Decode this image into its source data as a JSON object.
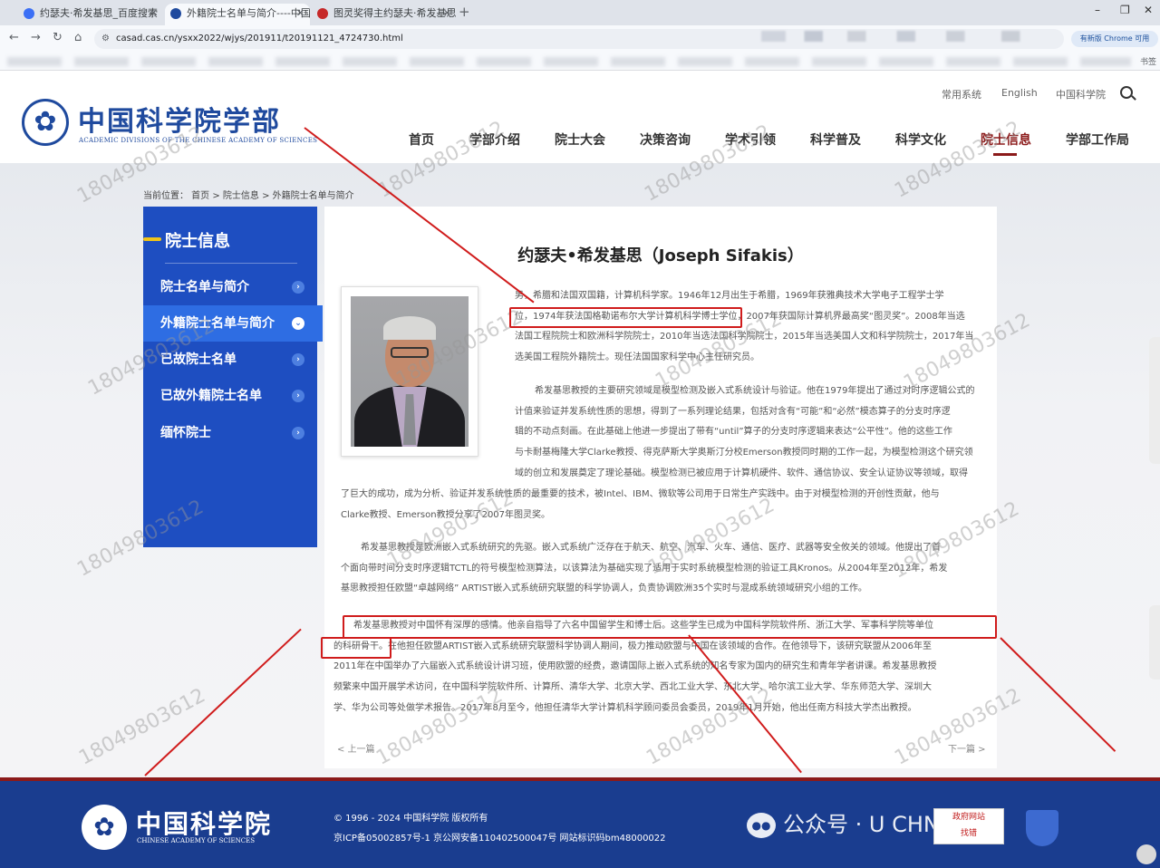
{
  "browser": {
    "tabs": [
      {
        "title": "约瑟夫·希发基思_百度搜索",
        "icon_color": "#3b6ff5"
      },
      {
        "title": "外籍院士名单与简介----中国科",
        "icon_color": "#1f4a9e"
      },
      {
        "title": "图灵奖得主约瑟夫·希发基思: 深",
        "icon_color": "#c62828"
      }
    ],
    "close_glyph": "✕",
    "new_tab_glyph": "+",
    "url": "casad.cas.cn/ysxx2022/wjys/201911/t20191121_4724730.html",
    "chrome_notice": "有新版 Chrome 可用",
    "bookmarks_right": "书签"
  },
  "header": {
    "logo_cn": "中国科学院学部",
    "logo_en": "ACADEMIC DIVISIONS OF THE CHINESE ACADEMY OF SCIENCES",
    "top_links": [
      "常用系统",
      "English",
      "中国科学院"
    ],
    "nav": [
      "首页",
      "学部介绍",
      "院士大会",
      "决策咨询",
      "学术引领",
      "科学普及",
      "科学文化",
      "院士信息",
      "学部工作局"
    ],
    "nav_active": "院士信息",
    "accent_color": "#8b1a1a",
    "brand_color": "#1f4a9e"
  },
  "breadcrumb": "当前位置： 首页 > 院士信息 > 外籍院士名单与简介",
  "sidebar": {
    "title": "院士信息",
    "items": [
      {
        "label": "院士名单与简介",
        "active": false
      },
      {
        "label": "外籍院士名单与简介",
        "active": true
      },
      {
        "label": "已故院士名单",
        "active": false
      },
      {
        "label": "已故外籍院士名单",
        "active": false
      },
      {
        "label": "缅怀院士",
        "active": false
      }
    ],
    "color": "#1e4ec1"
  },
  "article": {
    "title": "约瑟夫•希发基思（Joseph Sifakis）",
    "paragraphs": [
      [
        "男，希腊和法国双国籍，计算机科学家。1946年12月出生于希腊，1969年获雅典技术大学电子工程学士学",
        "位，1974年获法国格勒诺布尔大学计算机科学博士学位，2007年获国际计算机界最高奖“图灵奖”。2008年当选",
        "法国工程院院士和欧洲科学院院士，2010年当选法国科学院院士，2015年当选美国人文和科学院院士，2017年当",
        "选美国工程院外籍院士。现任法国国家科学中心主任研究员。"
      ],
      [
        "希发基思教授的主要研究领域是模型检测及嵌入式系统设计与验证。他在1979年提出了通过对时序逻辑公式的",
        "计值来验证并发系统性质的思想，得到了一系列理论结果，包括对含有“可能”和“必然”模态算子的分支时序逻",
        "辑的不动点刻画。在此基础上他进一步提出了带有“until”算子的分支时序逻辑来表达“公平性”。他的这些工作",
        "与卡耐基梅隆大学Clarke教授、得克萨斯大学奥斯汀分校Emerson教授同时期的工作一起，为模型检测这个研究领",
        "域的创立和发展奠定了理论基础。模型检测已被应用于计算机硬件、软件、通信协议、安全认证协议等领域，取得",
        "了巨大的成功，成为分析、验证并发系统性质的最重要的技术，被Intel、IBM、微软等公司用于日常生产实践中。由于对模型检测的开创性贡献，他与",
        "Clarke教授、Emerson教授分享了2007年图灵奖。"
      ],
      [
        "希发基思教授是欧洲嵌入式系统研究的先驱。嵌入式系统广泛存在于航天、航空、汽车、火车、通信、医疗、武器等安全攸关的领域。他提出了首",
        "个面向带时间分支时序逻辑TCTL的符号模型检测算法，以该算法为基础实现了适用于实时系统模型检测的验证工具Kronos。从2004年至2012年，希发",
        "基思教授担任欧盟“卓越网络” ARTIST嵌入式系统研究联盟的科学协调人，负责协调欧洲35个实时与混成系统领域研究小组的工作。"
      ],
      [
        "希发基思教授对中国怀有深厚的感情。他亲自指导了六名中国留学生和博士后。这些学生已成为中国科学院软件所、浙江大学、军事科学院等单位",
        "的科研骨干。在他担任欧盟ARTIST嵌入式系统研究联盟科学协调人期间，极力推动欧盟与中国在该领域的合作。在他领导下，该研究联盟从2006年至",
        "2011年在中国举办了六届嵌入式系统设计讲习班，使用欧盟的经费，邀请国际上嵌入式系统的知名专家为国内的研究生和青年学者讲课。希发基思教授",
        "频繁来中国开展学术访问，在中国科学院软件所、计算所、清华大学、北京大学、西北工业大学、东北大学、哈尔滨工业大学、华东师范大学、深圳大",
        "学、华为公司等处做学术报告。2017年8月至今，他担任清华大学计算机科学顾问委员会委员，2019年1月开始，他出任南方科技大学杰出教授。"
      ]
    ],
    "prev": "< 上一篇",
    "next": "下一篇 >"
  },
  "watermark": "18049803612",
  "footer": {
    "logo_cn": "中国科学院",
    "logo_en": "CHINESE ACADEMY OF SCIENCES",
    "copyright": "© 1996 - 2024 中国科学院 版权所有",
    "icp": "京ICP备05002857号-1  京公网安备110402500047号  网站标识码bm48000022",
    "wechat_overlay": "公众号 · U    CHN硕博",
    "gov_badge": [
      "政府网站",
      "找错"
    ],
    "bg_color": "#1a3d8f"
  }
}
